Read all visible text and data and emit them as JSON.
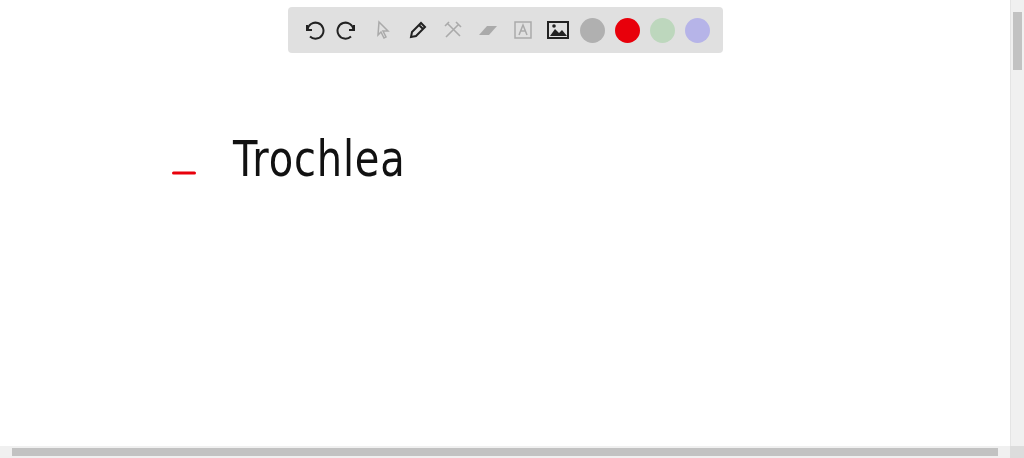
{
  "toolbar": {
    "tools": [
      {
        "kind": "undo",
        "disabled": false
      },
      {
        "kind": "redo",
        "disabled": false
      },
      {
        "kind": "pointer",
        "disabled": true
      },
      {
        "kind": "pen",
        "disabled": false
      },
      {
        "kind": "tools",
        "disabled": true
      },
      {
        "kind": "eraser",
        "disabled": true
      },
      {
        "kind": "text",
        "disabled": true
      },
      {
        "kind": "image",
        "disabled": false
      }
    ],
    "colors": [
      {
        "color": "#b0b0b0"
      },
      {
        "color": "#e8000b"
      },
      {
        "color": "#bdd7bd"
      },
      {
        "color": "#b6b4e8"
      }
    ]
  },
  "canvas": {
    "strokes": [
      {
        "kind": "dash",
        "color": "#e8000b"
      }
    ],
    "notes": [
      {
        "text": "Trochlea"
      }
    ]
  }
}
